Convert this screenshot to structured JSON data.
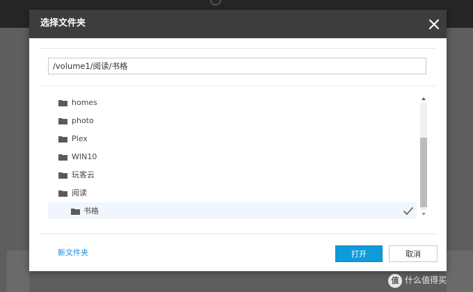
{
  "dialog": {
    "title": "选择文件夹",
    "close_icon": "close-icon"
  },
  "path": {
    "value": "/volume1/阅读/书格"
  },
  "tree": {
    "items": [
      {
        "label": "homes",
        "level": 0,
        "selected": false
      },
      {
        "label": "photo",
        "level": 0,
        "selected": false
      },
      {
        "label": "Plex",
        "level": 0,
        "selected": false
      },
      {
        "label": "WIN10",
        "level": 0,
        "selected": false
      },
      {
        "label": "玩客云",
        "level": 0,
        "selected": false
      },
      {
        "label": "阅读",
        "level": 0,
        "selected": false
      },
      {
        "label": "书格",
        "level": 1,
        "selected": true
      }
    ]
  },
  "footer": {
    "new_folder_label": "新文件夹",
    "open_label": "打开",
    "cancel_label": "取消"
  },
  "watermark": {
    "badge": "值",
    "text": "什么值得买"
  },
  "colors": {
    "header_bg": "#3d3d3d",
    "primary": "#0f9ad8",
    "link": "#1a8fd6",
    "selected_row": "#f1f6fc",
    "folder_icon": "#5a5a5a"
  }
}
